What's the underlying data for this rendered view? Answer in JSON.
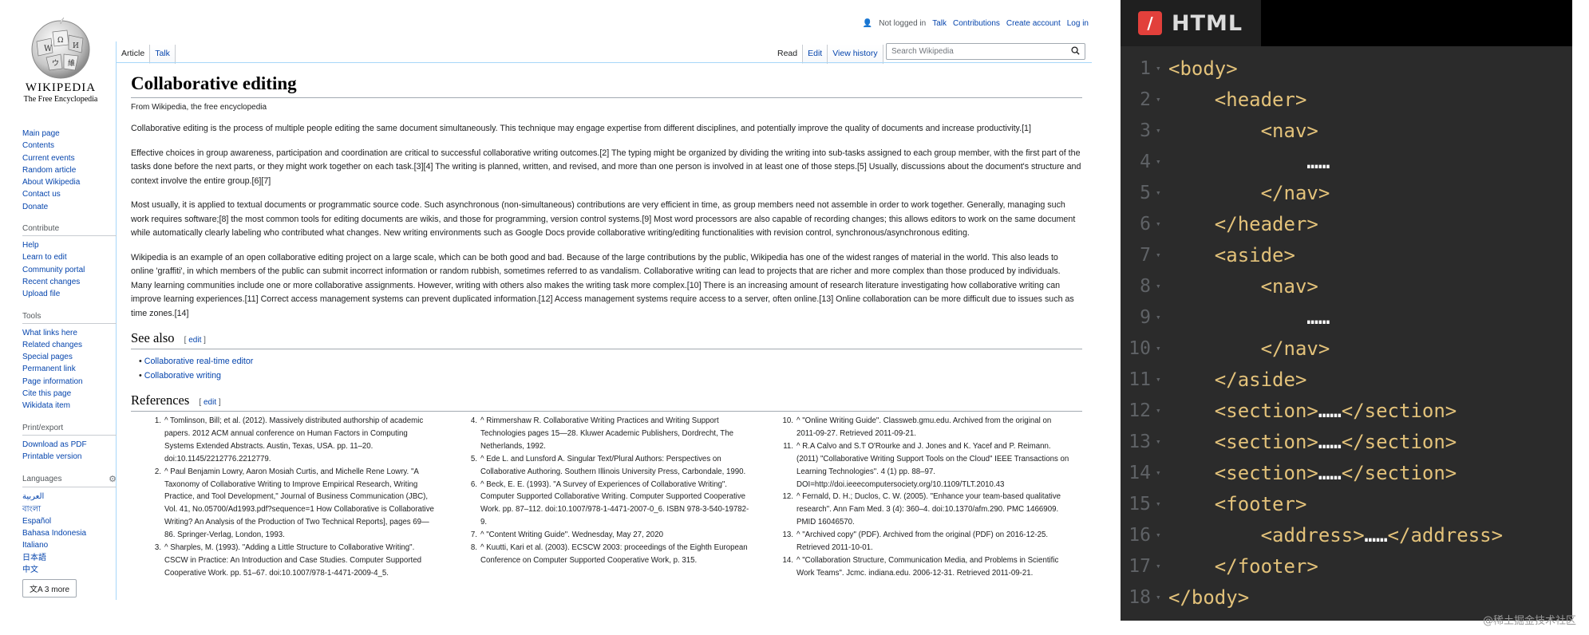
{
  "wiki": {
    "logo": {
      "title": "WIKIPEDIA",
      "tagline": "The Free Encyclopedia"
    },
    "user_tools": [
      "Not logged in",
      "Talk",
      "Contributions",
      "Create account",
      "Log in"
    ],
    "tabs_left": [
      "Article",
      "Talk"
    ],
    "tabs_right": [
      "Read",
      "Edit",
      "View history"
    ],
    "search_placeholder": "Search Wikipedia",
    "sidebar": {
      "main_links": [
        "Main page",
        "Contents",
        "Current events",
        "Random article",
        "About Wikipedia",
        "Contact us",
        "Donate"
      ],
      "contribute_heading": "Contribute",
      "contribute_links": [
        "Help",
        "Learn to edit",
        "Community portal",
        "Recent changes",
        "Upload file"
      ],
      "tools_heading": "Tools",
      "tools_links": [
        "What links here",
        "Related changes",
        "Special pages",
        "Permanent link",
        "Page information",
        "Cite this page",
        "Wikidata item"
      ],
      "print_heading": "Print/export",
      "print_links": [
        "Download as PDF",
        "Printable version"
      ],
      "languages_heading": "Languages",
      "languages": [
        "العربية",
        "বাংলা",
        "Español",
        "Bahasa Indonesia",
        "Italiano",
        "日本語",
        "中文"
      ],
      "more_languages": "3 more"
    },
    "article": {
      "title": "Collaborative editing",
      "subtitle": "From Wikipedia, the free encyclopedia",
      "p1": "Collaborative editing is the process of multiple people editing the same document simultaneously. This technique may engage expertise from different disciplines, and potentially improve the quality of documents and increase productivity.[1]",
      "p2": "Effective choices in group awareness, participation and coordination are critical to successful collaborative writing outcomes.[2] The typing might be organized by dividing the writing into sub-tasks assigned to each group member, with the first part of the tasks done before the next parts, or they might work together on each task.[3][4] The writing is planned, written, and revised, and more than one person is involved in at least one of those steps.[5] Usually, discussions about the document's structure and context involve the entire group.[6][7]",
      "p3": "Most usually, it is applied to textual documents or programmatic source code. Such asynchronous (non-simultaneous) contributions are very efficient in time, as group members need not assemble in order to work together. Generally, managing such work requires software;[8] the most common tools for editing documents are wikis, and those for programming, version control systems.[9] Most word processors are also capable of recording changes; this allows editors to work on the same document while automatically clearly labeling who contributed what changes. New writing environments such as Google Docs provide collaborative writing/editing functionalities with revision control, synchronous/asynchronous editing.",
      "p4": "Wikipedia is an example of an open collaborative editing project on a large scale, which can be both good and bad. Because of the large contributions by the public, Wikipedia has one of the widest ranges of material in the world. This also leads to online 'graffiti', in which members of the public can submit incorrect information or random rubbish, sometimes referred to as vandalism. Collaborative writing can lead to projects that are richer and more complex than those produced by individuals. Many learning communities include one or more collaborative assignments. However, writing with others also makes the writing task more complex.[10] There is an increasing amount of research literature investigating how collaborative writing can improve learning experiences.[11] Correct access management systems can prevent duplicated information.[12] Access management systems require access to a server, often online.[13] Online collaboration can be more difficult due to issues such as time zones.[14]",
      "see_also_heading": "See also",
      "edit_label": "edit",
      "see_also": [
        "Collaborative real-time editor",
        "Collaborative writing"
      ],
      "references_heading": "References",
      "references": [
        {
          "num": "1.",
          "text": "^ Tomlinson, Bill; et al. (2012). Massively distributed authorship of academic papers. 2012 ACM annual conference on Human Factors in Computing Systems Extended Abstracts. Austin, Texas, USA. pp. 11–20. doi:10.1145/2212776.2212779."
        },
        {
          "num": "2.",
          "text": "^ Paul Benjamin Lowry, Aaron Mosiah Curtis, and Michelle Rene Lowry. \"A Taxonomy of Collaborative Writing to Improve Empirical Research, Writing Practice, and Tool Development,\" Journal of Business Communication (JBC), Vol. 41, No.05700/Ad1993.pdf?sequence=1 How Collaborative is Collaborative Writing? An Analysis of the Production of Two Technical Reports], pages 69—86. Springer-Verlag, London, 1993."
        },
        {
          "num": "3.",
          "text": "^ Sharples, M. (1993). \"Adding a Little Structure to Collaborative Writing\". CSCW in Practice: An Introduction and Case Studies. Computer Supported Cooperative Work. pp. 51–67. doi:10.1007/978-1-4471-2009-4_5."
        },
        {
          "num": "4.",
          "text": "^ Rimmershaw R. Collaborative Writing Practices and Writing Support Technologies pages 15—28. Kluwer Academic Publishers, Dordrecht, The Netherlands, 1992."
        },
        {
          "num": "5.",
          "text": "^ Ede L. and Lunsford A. Singular Text/Plural Authors: Perspectives on Collaborative Authoring. Southern Illinois University Press, Carbondale, 1990."
        },
        {
          "num": "6.",
          "text": "^ Beck, E. E. (1993). \"A Survey of Experiences of Collaborative Writing\". Computer Supported Collaborative Writing. Computer Supported Cooperative Work. pp. 87–112. doi:10.1007/978-1-4471-2007-0_6. ISBN 978-3-540-19782-9."
        },
        {
          "num": "7.",
          "text": "^ \"Content Writing Guide\". Wednesday, May 27, 2020"
        },
        {
          "num": "8.",
          "text": "^ Kuutti, Kari et al. (2003). ECSCW 2003: proceedings of the Eighth European Conference on Computer Supported Cooperative Work, p. 315."
        },
        {
          "num": "10.",
          "text": "^ \"Online Writing Guide\". Classweb.gmu.edu. Archived from the original on 2011-09-27. Retrieved 2011-09-21."
        },
        {
          "num": "11.",
          "text": "^ R.A Calvo and S.T O'Rourke and J. Jones and K. Yacef and P. Reimann. (2011) \"Collaborative Writing Support Tools on the Cloud\" IEEE Transactions on Learning Technologies\". 4 (1) pp. 88–97. DOI=http://doi.ieeecomputersociety.org/10.1109/TLT.2010.43"
        },
        {
          "num": "12.",
          "text": "^ Fernald, D. H.; Duclos, C. W. (2005). \"Enhance your team-based qualitative research\". Ann Fam Med. 3 (4): 360–4. doi:10.1370/afm.290. PMC 1466909. PMID 16046570."
        },
        {
          "num": "13.",
          "text": "^ \"Archived copy\" (PDF). Archived from the original (PDF) on 2016-12-25. Retrieved 2011-10-01."
        },
        {
          "num": "14.",
          "text": "^ \"Collaboration Structure, Communication Media, and Problems in Scientific Work Teams\". Jcmc. indiana.edu. 2006-12-31. Retrieved 2011-09-21."
        }
      ]
    }
  },
  "code_panel": {
    "label": "HTML",
    "badge": "/",
    "lines": [
      {
        "n": "1",
        "code": "<body>"
      },
      {
        "n": "2",
        "code": "    <header>"
      },
      {
        "n": "3",
        "code": "        <nav>"
      },
      {
        "n": "4",
        "code": "            ……"
      },
      {
        "n": "5",
        "code": "        </nav>"
      },
      {
        "n": "6",
        "code": "    </header>"
      },
      {
        "n": "7",
        "code": "    <aside>"
      },
      {
        "n": "8",
        "code": "        <nav>"
      },
      {
        "n": "9",
        "code": "            ……"
      },
      {
        "n": "10",
        "code": "        </nav>"
      },
      {
        "n": "11",
        "code": "    </aside>"
      },
      {
        "n": "12",
        "code": "    <section>……</section>"
      },
      {
        "n": "13",
        "code": "    <section>……</section>"
      },
      {
        "n": "14",
        "code": "    <section>……</section>"
      },
      {
        "n": "15",
        "code": "    <footer>"
      },
      {
        "n": "16",
        "code": "        <address>……</address>"
      },
      {
        "n": "17",
        "code": "    </footer>"
      },
      {
        "n": "18",
        "code": "</body>"
      }
    ]
  },
  "credit": "@稀土掘金技术社区",
  "colors": {
    "link": "#0645ad",
    "code_bg": "#2b2b2b",
    "code_tag": "#e3c27a",
    "badge": "#e2403b"
  }
}
